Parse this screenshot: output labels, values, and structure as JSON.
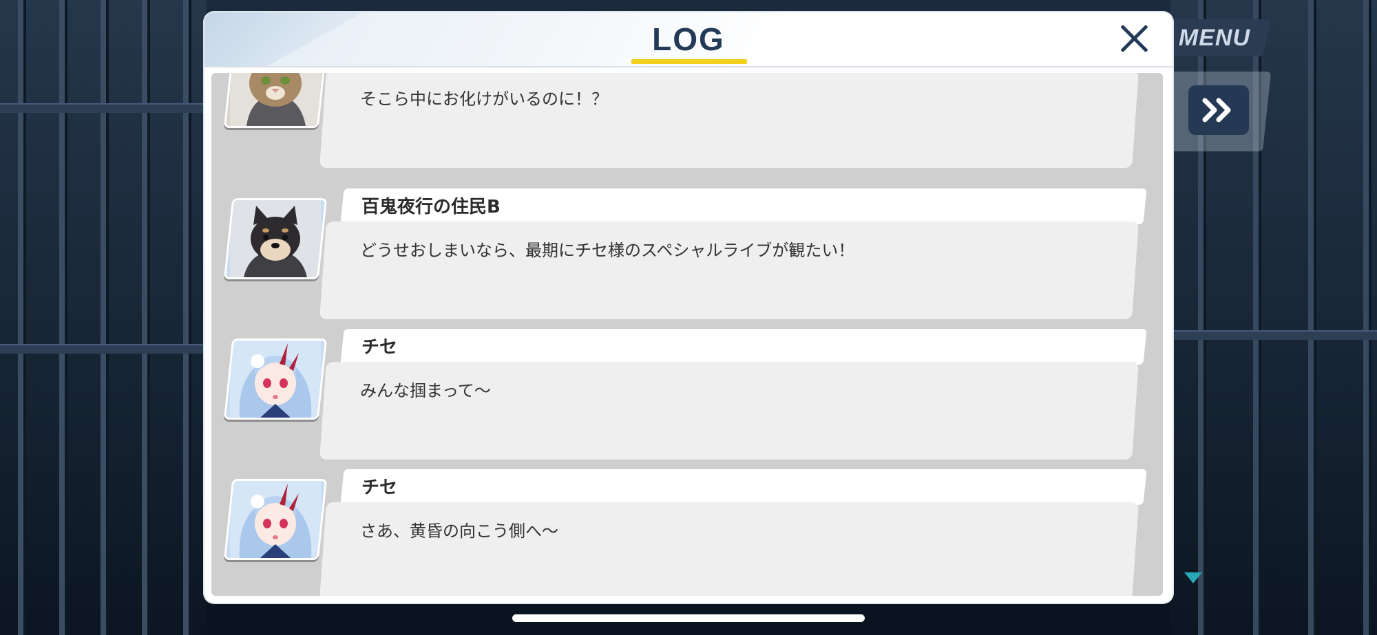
{
  "background": {
    "menu_label": "MENU"
  },
  "log": {
    "title": "LOG",
    "entries": [
      {
        "speaker": "",
        "text": "そこら中にお化けがいるのに！？",
        "avatar": "cat-avatar-icon"
      },
      {
        "speaker": "百鬼夜行の住民B",
        "text": "どうせおしまいなら、最期にチセ様のスペシャルライブが観たい！",
        "avatar": "shiba-avatar-icon"
      },
      {
        "speaker": "チセ",
        "text": "みんな掴まって〜",
        "avatar": "chise-avatar-icon"
      },
      {
        "speaker": "チセ",
        "text": "さあ、黄昏の向こう側へ〜",
        "avatar": "chise-avatar-icon"
      }
    ]
  },
  "colors": {
    "title": "#243a59",
    "accent_underline": "#f2d01d",
    "skip_button": "#253954",
    "scroll_arrow": "#2aa7b6"
  }
}
